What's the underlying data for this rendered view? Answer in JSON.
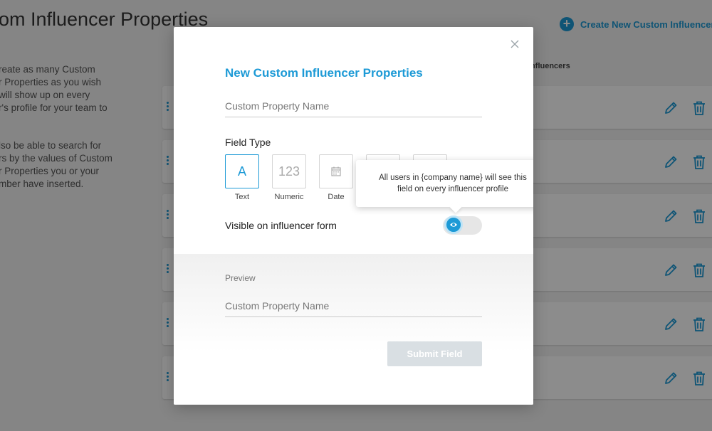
{
  "page": {
    "title": "om Influencer Properties",
    "create_button_label": "Create New Custom Influencer Pr",
    "column_header": "Influencers",
    "description": [
      "reate as many Custom\nr Properties as you wish\nwill show up on every\nr's profile for your team to",
      "lso be able to search for\nrs by the values of Custom\nr Properties you or your\nmber have inserted."
    ],
    "row_count": 6
  },
  "modal": {
    "title": "New Custom Influencer Properties",
    "name_placeholder": "Custom Property Name",
    "field_type_label": "Field Type",
    "field_types": [
      {
        "label": "Text",
        "glyph": "A",
        "selected": true
      },
      {
        "label": "Numeric",
        "glyph": "123",
        "selected": false
      },
      {
        "label": "Date",
        "icon": "calendar-icon",
        "selected": false
      }
    ],
    "visible_label": "Visible on influencer form",
    "visible_toggle_on": true,
    "tooltip": "All users in {company name} will see this\nfield on every influencer profile",
    "preview_label": "Preview",
    "preview_placeholder": "Custom Property Name",
    "submit_label": "Submit Field"
  },
  "colors": {
    "accent": "#1d9ad6",
    "submit_disabled": "#d9dfe3",
    "overlay": "rgba(0,0,0,0.45)"
  }
}
